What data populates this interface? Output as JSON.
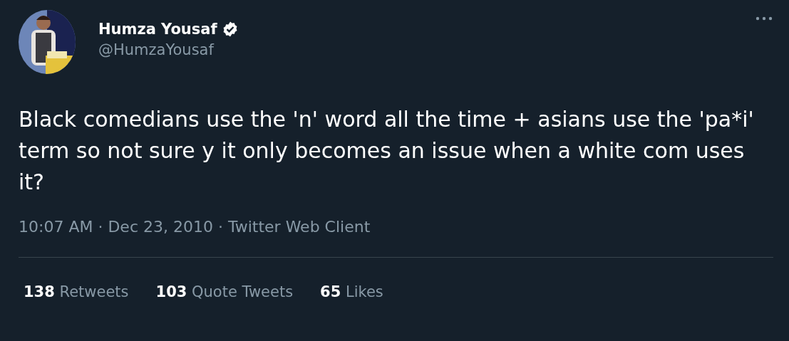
{
  "author": {
    "name": "Humza Yousaf",
    "verified": true,
    "handle": "@HumzaYousaf"
  },
  "tweet": {
    "text": "Black comedians use the 'n' word all the time + asians use the 'pa*i' term so not sure y it only becomes an issue when a white com uses it?",
    "meta": "10:07 AM · Dec 23, 2010 · Twitter Web Client"
  },
  "stats": [
    {
      "text": "**138** Retweets"
    },
    {
      "text": "**103** Quote Tweets"
    },
    {
      "text": "**65** Likes"
    }
  ]
}
